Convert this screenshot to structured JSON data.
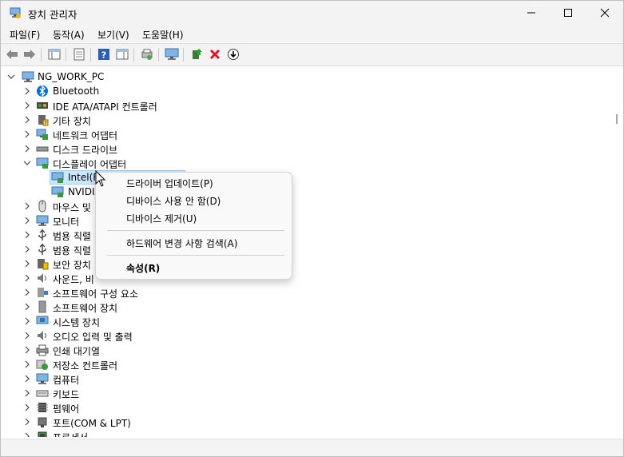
{
  "window": {
    "title": "장치 관리자"
  },
  "menu": [
    "파일(F)",
    "동작(A)",
    "보기(V)",
    "도움말(H)"
  ],
  "tree": {
    "root": "NG_WORK_PC",
    "items": [
      {
        "label": "Bluetooth",
        "icon": "bluetooth-icon"
      },
      {
        "label": "IDE ATA/ATAPI 컨트롤러",
        "icon": "ide-controller-icon"
      },
      {
        "label": "기타 장치",
        "icon": "other-devices-icon"
      },
      {
        "label": "네트워크 어댑터",
        "icon": "network-adapter-icon"
      },
      {
        "label": "디스크 드라이브",
        "icon": "disk-drive-icon"
      },
      {
        "label": "디스플레이 어댑터",
        "icon": "display-adapter-icon",
        "expanded": true,
        "children": [
          {
            "label": "Intel(R"
          },
          {
            "label": "NVIDIA"
          }
        ]
      },
      {
        "label": "마우스 및",
        "icon": "mouse-icon"
      },
      {
        "label": "모니터",
        "icon": "monitor-icon"
      },
      {
        "label": "범용 직렬",
        "icon": "usb-icon"
      },
      {
        "label": "범용 직렬",
        "icon": "usb-icon"
      },
      {
        "label": "보안 장치",
        "icon": "security-device-icon"
      },
      {
        "label": "사운드, 비",
        "icon": "sound-icon"
      },
      {
        "label": "소프트웨어 구성 요소",
        "icon": "software-component-icon"
      },
      {
        "label": "소프트웨어 장치",
        "icon": "software-device-icon"
      },
      {
        "label": "시스템 장치",
        "icon": "system-device-icon"
      },
      {
        "label": "오디오 입력 및 출력",
        "icon": "audio-io-icon"
      },
      {
        "label": "인쇄 대기열",
        "icon": "printer-icon"
      },
      {
        "label": "저장소 컨트롤러",
        "icon": "storage-controller-icon"
      },
      {
        "label": "컴퓨터",
        "icon": "computer-icon"
      },
      {
        "label": "키보드",
        "icon": "keyboard-icon"
      },
      {
        "label": "펌웨어",
        "icon": "firmware-icon"
      },
      {
        "label": "포트(COM & LPT)",
        "icon": "port-icon"
      },
      {
        "label": "프로세서",
        "icon": "processor-icon"
      }
    ]
  },
  "context_menu": {
    "update_driver": "드라이버 업데이트(P)",
    "disable_device": "디바이스 사용 안 함(D)",
    "uninstall_device": "디바이스 제거(U)",
    "scan_hardware": "하드웨어 변경 사항 검색(A)",
    "properties": "속성(R)"
  },
  "colors": {
    "selection": "#cce8ff",
    "accent": "#0067c0",
    "delete": "#e81123"
  }
}
